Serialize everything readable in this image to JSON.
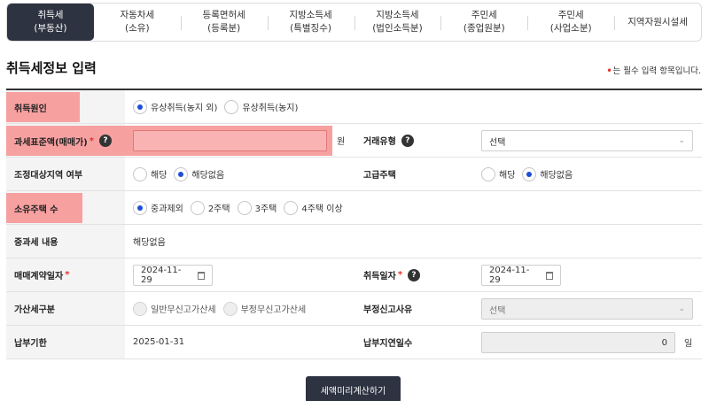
{
  "tabs": [
    {
      "line1": "취득세",
      "line2": "(부동산)"
    },
    {
      "line1": "자동차세",
      "line2": "(소유)"
    },
    {
      "line1": "등록면허세",
      "line2": "(등록분)"
    },
    {
      "line1": "지방소득세",
      "line2": "(특별징수)"
    },
    {
      "line1": "지방소득세",
      "line2": "(법인소득분)"
    },
    {
      "line1": "주민세",
      "line2": "(종업원분)"
    },
    {
      "line1": "주민세",
      "line2": "(사업소분)"
    },
    {
      "line1": "지역자원시설세",
      "line2": ""
    }
  ],
  "page_title": "취득세정보 입력",
  "required_note": {
    "dot": "•",
    "text": "는 필수 입력 항목입니다."
  },
  "form": {
    "cause": {
      "label": "취득원인",
      "options": [
        "유상취득(농지 외)",
        "유상취득(농지)"
      ],
      "selected": 0
    },
    "tax_base": {
      "label": "과세표준액(매매가)",
      "star": "*",
      "help": "?",
      "value": "",
      "unit": "원"
    },
    "trade_type": {
      "label": "거래유형",
      "help": "?",
      "value": "선택"
    },
    "adjust_area": {
      "label": "조정대상지역 여부",
      "options": [
        "해당",
        "해당없음"
      ],
      "selected": 1
    },
    "luxury": {
      "label": "고급주택",
      "options": [
        "해당",
        "해당없음"
      ],
      "selected": 1
    },
    "houses": {
      "label": "소유주택 수",
      "options": [
        "중과제외",
        "2주택",
        "3주택",
        "4주택 이상"
      ],
      "selected": 0
    },
    "heavy_content": {
      "label": "중과세 내용",
      "value": "해당없음"
    },
    "contract_date": {
      "label": "매매계약일자",
      "star": "*",
      "value": "2024-11-29"
    },
    "acquire_date": {
      "label": "취득일자",
      "star": "*",
      "help": "?",
      "value": "2024-11-29"
    },
    "add_tax": {
      "label": "가산세구분",
      "options": [
        "일반무신고가산세",
        "부정무신고가산세"
      ]
    },
    "improper_reason": {
      "label": "부정신고사유",
      "value": "선택"
    },
    "due_date": {
      "label": "납부기한",
      "value": "2025-01-31"
    },
    "delay_days": {
      "label": "납부지연일수",
      "value": "0",
      "unit": "일"
    }
  },
  "submit_button": "세액미리계산하기",
  "colors": {
    "dark": "#2d3340",
    "highlight": "#f7a0a0",
    "radio_on": "#1d4ed8",
    "required": "#e6302c"
  }
}
